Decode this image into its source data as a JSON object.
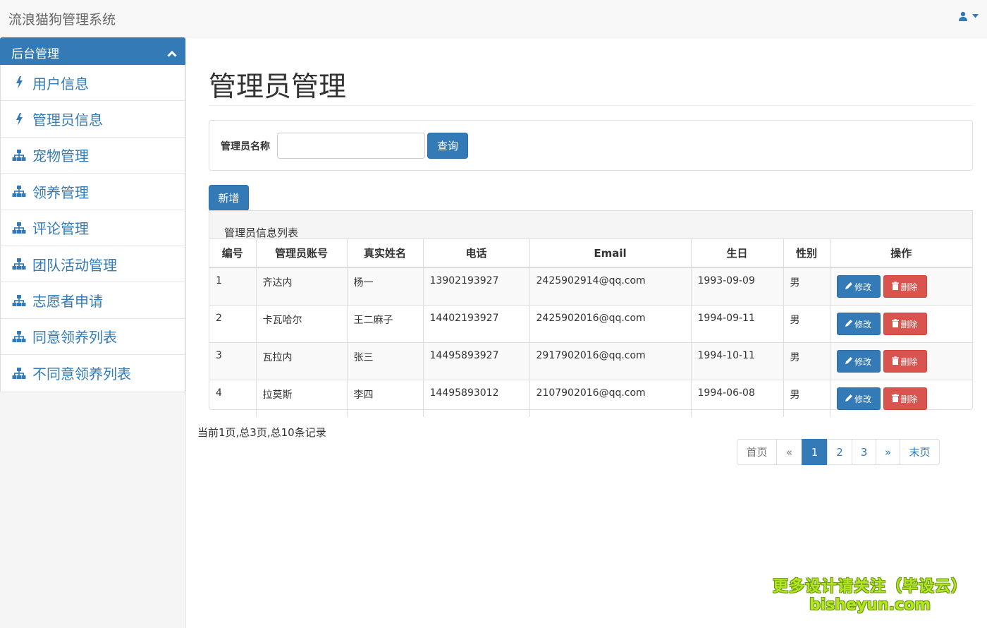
{
  "app": {
    "title": "流浪猫狗管理系统"
  },
  "sidebar": {
    "header": "后台管理",
    "items": [
      {
        "label": "用户信息",
        "icon": "flash-icon"
      },
      {
        "label": "管理员信息",
        "icon": "flash-icon"
      },
      {
        "label": "宠物管理",
        "icon": "sitemap-icon"
      },
      {
        "label": "领养管理",
        "icon": "sitemap-icon"
      },
      {
        "label": "评论管理",
        "icon": "sitemap-icon"
      },
      {
        "label": "团队活动管理",
        "icon": "sitemap-icon"
      },
      {
        "label": "志愿者申请",
        "icon": "sitemap-icon"
      },
      {
        "label": "同意领养列表",
        "icon": "sitemap-icon"
      },
      {
        "label": "不同意领养列表",
        "icon": "sitemap-icon"
      }
    ]
  },
  "main": {
    "title": "管理员管理",
    "search": {
      "label": "管理员名称",
      "value": "",
      "placeholder": "",
      "button": "查询"
    },
    "add_button": "新增",
    "table": {
      "caption": "管理员信息列表",
      "columns": [
        "编号",
        "管理员账号",
        "真实姓名",
        "电话",
        "Email",
        "生日",
        "性别",
        "操作"
      ],
      "rows": [
        [
          "1",
          "齐达内",
          "杨一",
          "13902193927",
          "2425902914@qq.com",
          "1993-09-09",
          "男"
        ],
        [
          "2",
          "卡瓦哈尔",
          "王二麻子",
          "14402193927",
          "2425902016@qq.com",
          "1994-09-11",
          "男"
        ],
        [
          "3",
          "瓦拉内",
          "张三",
          "14495893927",
          "2917902016@qq.com",
          "1994-10-11",
          "男"
        ],
        [
          "4",
          "拉莫斯",
          "李四",
          "14495893012",
          "2107902016@qq.com",
          "1994-06-08",
          "男"
        ]
      ],
      "edit_label": "修改",
      "delete_label": "删除"
    },
    "record_info": "当前1页,总3页,总10条记录",
    "pagination": {
      "first": "首页",
      "prev": "«",
      "pages": [
        "1",
        "2",
        "3"
      ],
      "current": "1",
      "next": "»",
      "last": "末页"
    }
  },
  "watermark": {
    "line1": "更多设计请关注（毕设云）",
    "line2": "bisheyun.com"
  },
  "colors": {
    "primary": "#337ab7",
    "danger": "#d9534f",
    "watermark": "#b5e61d"
  }
}
